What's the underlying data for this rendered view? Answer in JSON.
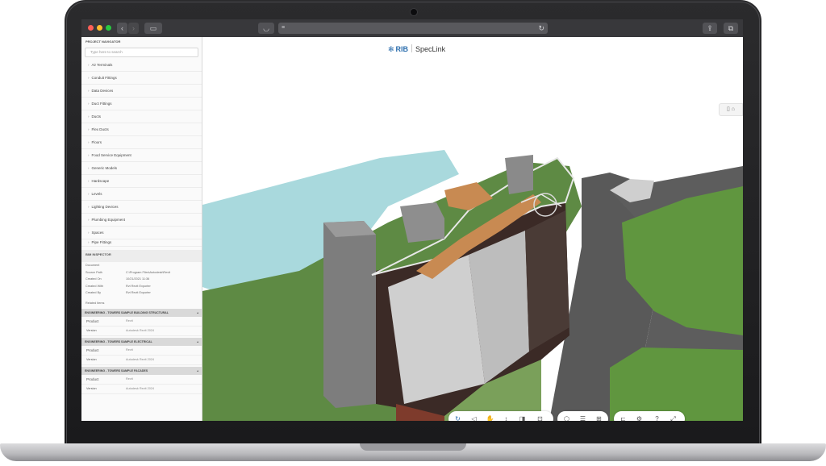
{
  "app": {
    "logo_mark": "RIB",
    "logo_product": "SpecLink"
  },
  "browser": {
    "address_text": ""
  },
  "sidebar": {
    "navigator_title": "PROJECT NAVIGATOR",
    "search_placeholder": "Type here to search",
    "tree_items": [
      {
        "label": "Air Terminals"
      },
      {
        "label": "Conduit Fittings"
      },
      {
        "label": "Data Devices"
      },
      {
        "label": "Duct Fittings"
      },
      {
        "label": "Ducts"
      },
      {
        "label": "Flex Ducts"
      },
      {
        "label": "Floors"
      },
      {
        "label": "Food Service Equipment"
      },
      {
        "label": "Generic Models"
      },
      {
        "label": "Hardscape"
      },
      {
        "label": "Levels"
      },
      {
        "label": "Lighting Devices"
      },
      {
        "label": "Plumbing Equipment"
      },
      {
        "label": "Spaces"
      },
      {
        "label": "Pipe Fittings"
      }
    ],
    "inspector_title": "BIM INSPECTOR",
    "properties": [
      {
        "label": "Document",
        "value": ""
      },
      {
        "label": "Source Path",
        "value": "C:\\Program Files\\Autodesk\\Revit"
      },
      {
        "label": "Created On",
        "value": "10/21/2021 11:36"
      },
      {
        "label": "Created With",
        "value": "Rvt Revit Exporter"
      },
      {
        "label": "Created By",
        "value": "Rvt Revit Exporter"
      }
    ],
    "related_label": "Related Items",
    "groups": [
      {
        "title": "ENGINEERING - TOWERS SAMPLE BUILDING STRUCTURAL",
        "rows": [
          {
            "label": "Product",
            "value": "Revit"
          },
          {
            "label": "Version",
            "value": "Autodesk Revit 2024"
          }
        ]
      },
      {
        "title": "ENGINEERING - TOWERS SAMPLE ELECTRICAL",
        "rows": [
          {
            "label": "Product",
            "value": "Revit"
          },
          {
            "label": "Version",
            "value": "Autodesk Revit 2024"
          }
        ]
      },
      {
        "title": "ENGINEERING - TOWERS SAMPLE FACADES",
        "rows": [
          {
            "label": "Product",
            "value": "Revit"
          },
          {
            "label": "Version",
            "value": "Autodesk Revit 2024"
          }
        ]
      }
    ]
  },
  "viewer": {
    "toolbar_groups": [
      {
        "icons": [
          "orbit-icon",
          "pan-icon",
          "hand-icon",
          "measure-icon",
          "section-icon",
          "fit-icon"
        ]
      },
      {
        "icons": [
          "cube-icon",
          "layers-icon",
          "explode-icon"
        ]
      },
      {
        "icons": [
          "model-browser-icon",
          "settings-icon",
          "help-icon",
          "fullscreen-icon"
        ]
      }
    ]
  },
  "colors": {
    "brand": "#2d6fae",
    "grass": "#5e8a44",
    "water": "#a9d9dd",
    "road": "#565656",
    "roof_path": "#c88a52"
  }
}
